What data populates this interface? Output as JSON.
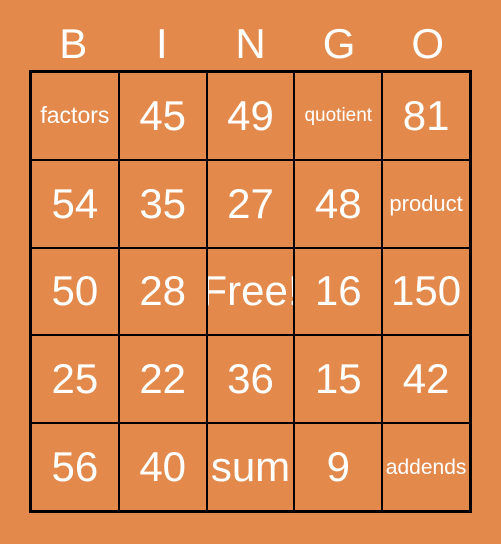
{
  "card": {
    "background_color": "#e2894b",
    "text_color": "#ffffff",
    "border_color": "#000000"
  },
  "header": {
    "letters": [
      "B",
      "I",
      "N",
      "G",
      "O"
    ]
  },
  "grid": {
    "rows": 5,
    "columns": 5,
    "cells": [
      {
        "text": "factors",
        "size": "size-m"
      },
      {
        "text": "45",
        "size": "size-xl"
      },
      {
        "text": "49",
        "size": "size-xl"
      },
      {
        "text": "quotient",
        "size": "size-xs"
      },
      {
        "text": "81",
        "size": "size-xl"
      },
      {
        "text": "54",
        "size": "size-xl"
      },
      {
        "text": "35",
        "size": "size-xl"
      },
      {
        "text": "27",
        "size": "size-xl"
      },
      {
        "text": "48",
        "size": "size-xl"
      },
      {
        "text": "product",
        "size": "size-m2"
      },
      {
        "text": "50",
        "size": "size-xl"
      },
      {
        "text": "28",
        "size": "size-xl"
      },
      {
        "text": "Free!",
        "size": "size-xl"
      },
      {
        "text": "16",
        "size": "size-xl"
      },
      {
        "text": "150",
        "size": "size-xl"
      },
      {
        "text": "25",
        "size": "size-xl"
      },
      {
        "text": "22",
        "size": "size-xl"
      },
      {
        "text": "36",
        "size": "size-xl"
      },
      {
        "text": "15",
        "size": "size-xl"
      },
      {
        "text": "42",
        "size": "size-xl"
      },
      {
        "text": "56",
        "size": "size-xl"
      },
      {
        "text": "40",
        "size": "size-xl"
      },
      {
        "text": "sum",
        "size": "size-xl"
      },
      {
        "text": "9",
        "size": "size-xl"
      },
      {
        "text": "addends",
        "size": "size-s"
      }
    ]
  }
}
